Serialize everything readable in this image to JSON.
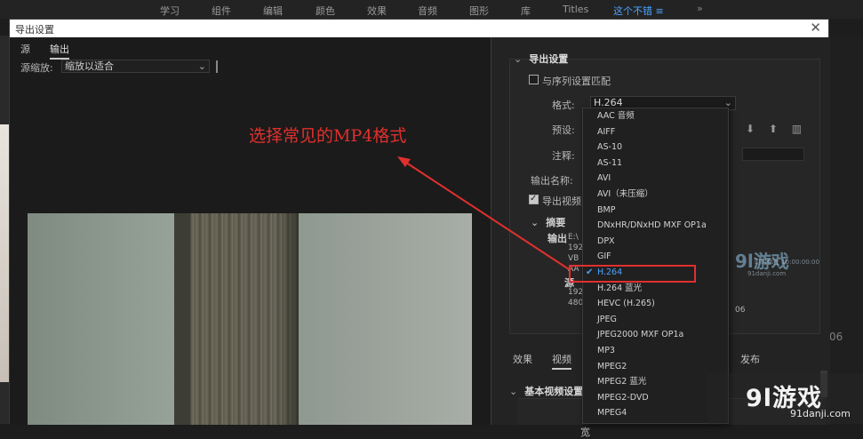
{
  "topbar": {
    "workspaces": [
      {
        "label": "学习"
      },
      {
        "label": "组件"
      },
      {
        "label": "编辑"
      },
      {
        "label": "颜色"
      },
      {
        "label": "效果"
      },
      {
        "label": "音频"
      },
      {
        "label": "图形"
      },
      {
        "label": "库"
      },
      {
        "label": "Titles"
      },
      {
        "label": "这个不错"
      }
    ],
    "active_menu_glyph": "≡",
    "more": "»"
  },
  "dialog": {
    "title": "导出设置",
    "close": "✕",
    "left": {
      "tabs": [
        {
          "label": "源"
        },
        {
          "label": "输出"
        }
      ],
      "scale_label": "源缩放:",
      "scale_value": "缩放以适合",
      "annotation": "选择常见的MP4格式"
    },
    "right": {
      "export_settings_title": "导出设置",
      "match_sequence_label": "与序列设置匹配",
      "format_label": "格式:",
      "format_value": "H.264",
      "preset_label": "预设:",
      "comment_label": "注释:",
      "output_name_label": "输出名称:",
      "export_video_label": "导出视频",
      "summary_label": "摘要",
      "summary_output_label": "输出",
      "summary_source_label": "源",
      "summary_lines": [
        "E:\\",
        "192",
        "VB",
        "AA",
        "192",
        "480"
      ],
      "summary_num": "06",
      "preset_icons": "⬇ ⬆ ▥",
      "watermark_text": "9l游戏",
      "watermark_sub": "91danji.com",
      "watermark_sub2": "时时都在 10:00:00:00"
    },
    "bottom": {
      "tabs": [
        {
          "label": "效果"
        },
        {
          "label": "视频"
        },
        {
          "label": "发布"
        }
      ],
      "basic_video_settings": "基本视频设置",
      "width_label": "宽"
    },
    "format_dropdown": {
      "options": [
        "AAC 音频",
        "AIFF",
        "AS-10",
        "AS-11",
        "AVI",
        "AVI（未压缩）",
        "BMP",
        "DNxHR/DNxHD MXF OP1a",
        "DPX",
        "GIF",
        "H.264",
        "H.264 蓝光",
        "HEVC (H.265)",
        "JPEG",
        "JPEG2000 MXF OP1a",
        "MP3",
        "MPEG2",
        "MPEG2 蓝光",
        "MPEG2-DVD",
        "MPEG4"
      ],
      "selected": "H.264",
      "check": "✔"
    }
  },
  "background": {
    "right_number": "06"
  },
  "logo": {
    "text": "9l游戏",
    "url": "91danji.com"
  },
  "colors": {
    "accent": "#4aa3ff",
    "annotation_red": "#e0302e"
  }
}
